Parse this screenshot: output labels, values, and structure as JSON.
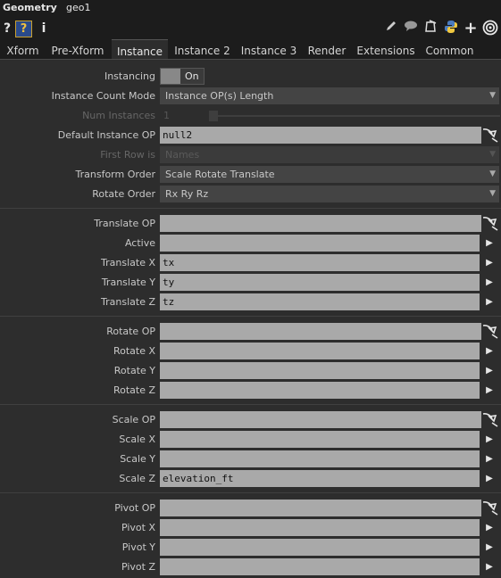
{
  "header": {
    "op_type": "Geometry",
    "op_name": "geo1"
  },
  "toolbar": {
    "help": "?",
    "help_op": "?",
    "info": "i"
  },
  "tabs": [
    "Xform",
    "Pre-Xform",
    "Instance",
    "Instance 2",
    "Instance 3",
    "Render",
    "Extensions",
    "Common"
  ],
  "active_tab": "Instance",
  "instancing": {
    "label": "Instancing",
    "value": "On"
  },
  "instance_count_mode": {
    "label": "Instance Count Mode",
    "value": "Instance OP(s) Length"
  },
  "num_instances": {
    "label": "Num Instances",
    "value": "1"
  },
  "default_instance_op": {
    "label": "Default Instance OP",
    "value": "null2"
  },
  "first_row_is": {
    "label": "First Row is",
    "value": "Names"
  },
  "transform_order": {
    "label": "Transform Order",
    "value": "Scale Rotate Translate"
  },
  "rotate_order": {
    "label": "Rotate Order",
    "value": "Rx Ry Rz"
  },
  "translate": {
    "op_label": "Translate OP",
    "op_value": "",
    "active_label": "Active",
    "active_value": "",
    "x_label": "Translate X",
    "x_value": "tx",
    "y_label": "Translate Y",
    "y_value": "ty",
    "z_label": "Translate Z",
    "z_value": "tz"
  },
  "rotate": {
    "op_label": "Rotate OP",
    "op_value": "",
    "x_label": "Rotate X",
    "x_value": "",
    "y_label": "Rotate Y",
    "y_value": "",
    "z_label": "Rotate Z",
    "z_value": ""
  },
  "scale": {
    "op_label": "Scale OP",
    "op_value": "",
    "x_label": "Scale X",
    "x_value": "",
    "y_label": "Scale Y",
    "y_value": "",
    "z_label": "Scale Z",
    "z_value": "elevation_ft"
  },
  "pivot": {
    "op_label": "Pivot OP",
    "op_value": "",
    "x_label": "Pivot X",
    "x_value": "",
    "y_label": "Pivot Y",
    "y_value": "",
    "z_label": "Pivot Z",
    "z_value": ""
  }
}
